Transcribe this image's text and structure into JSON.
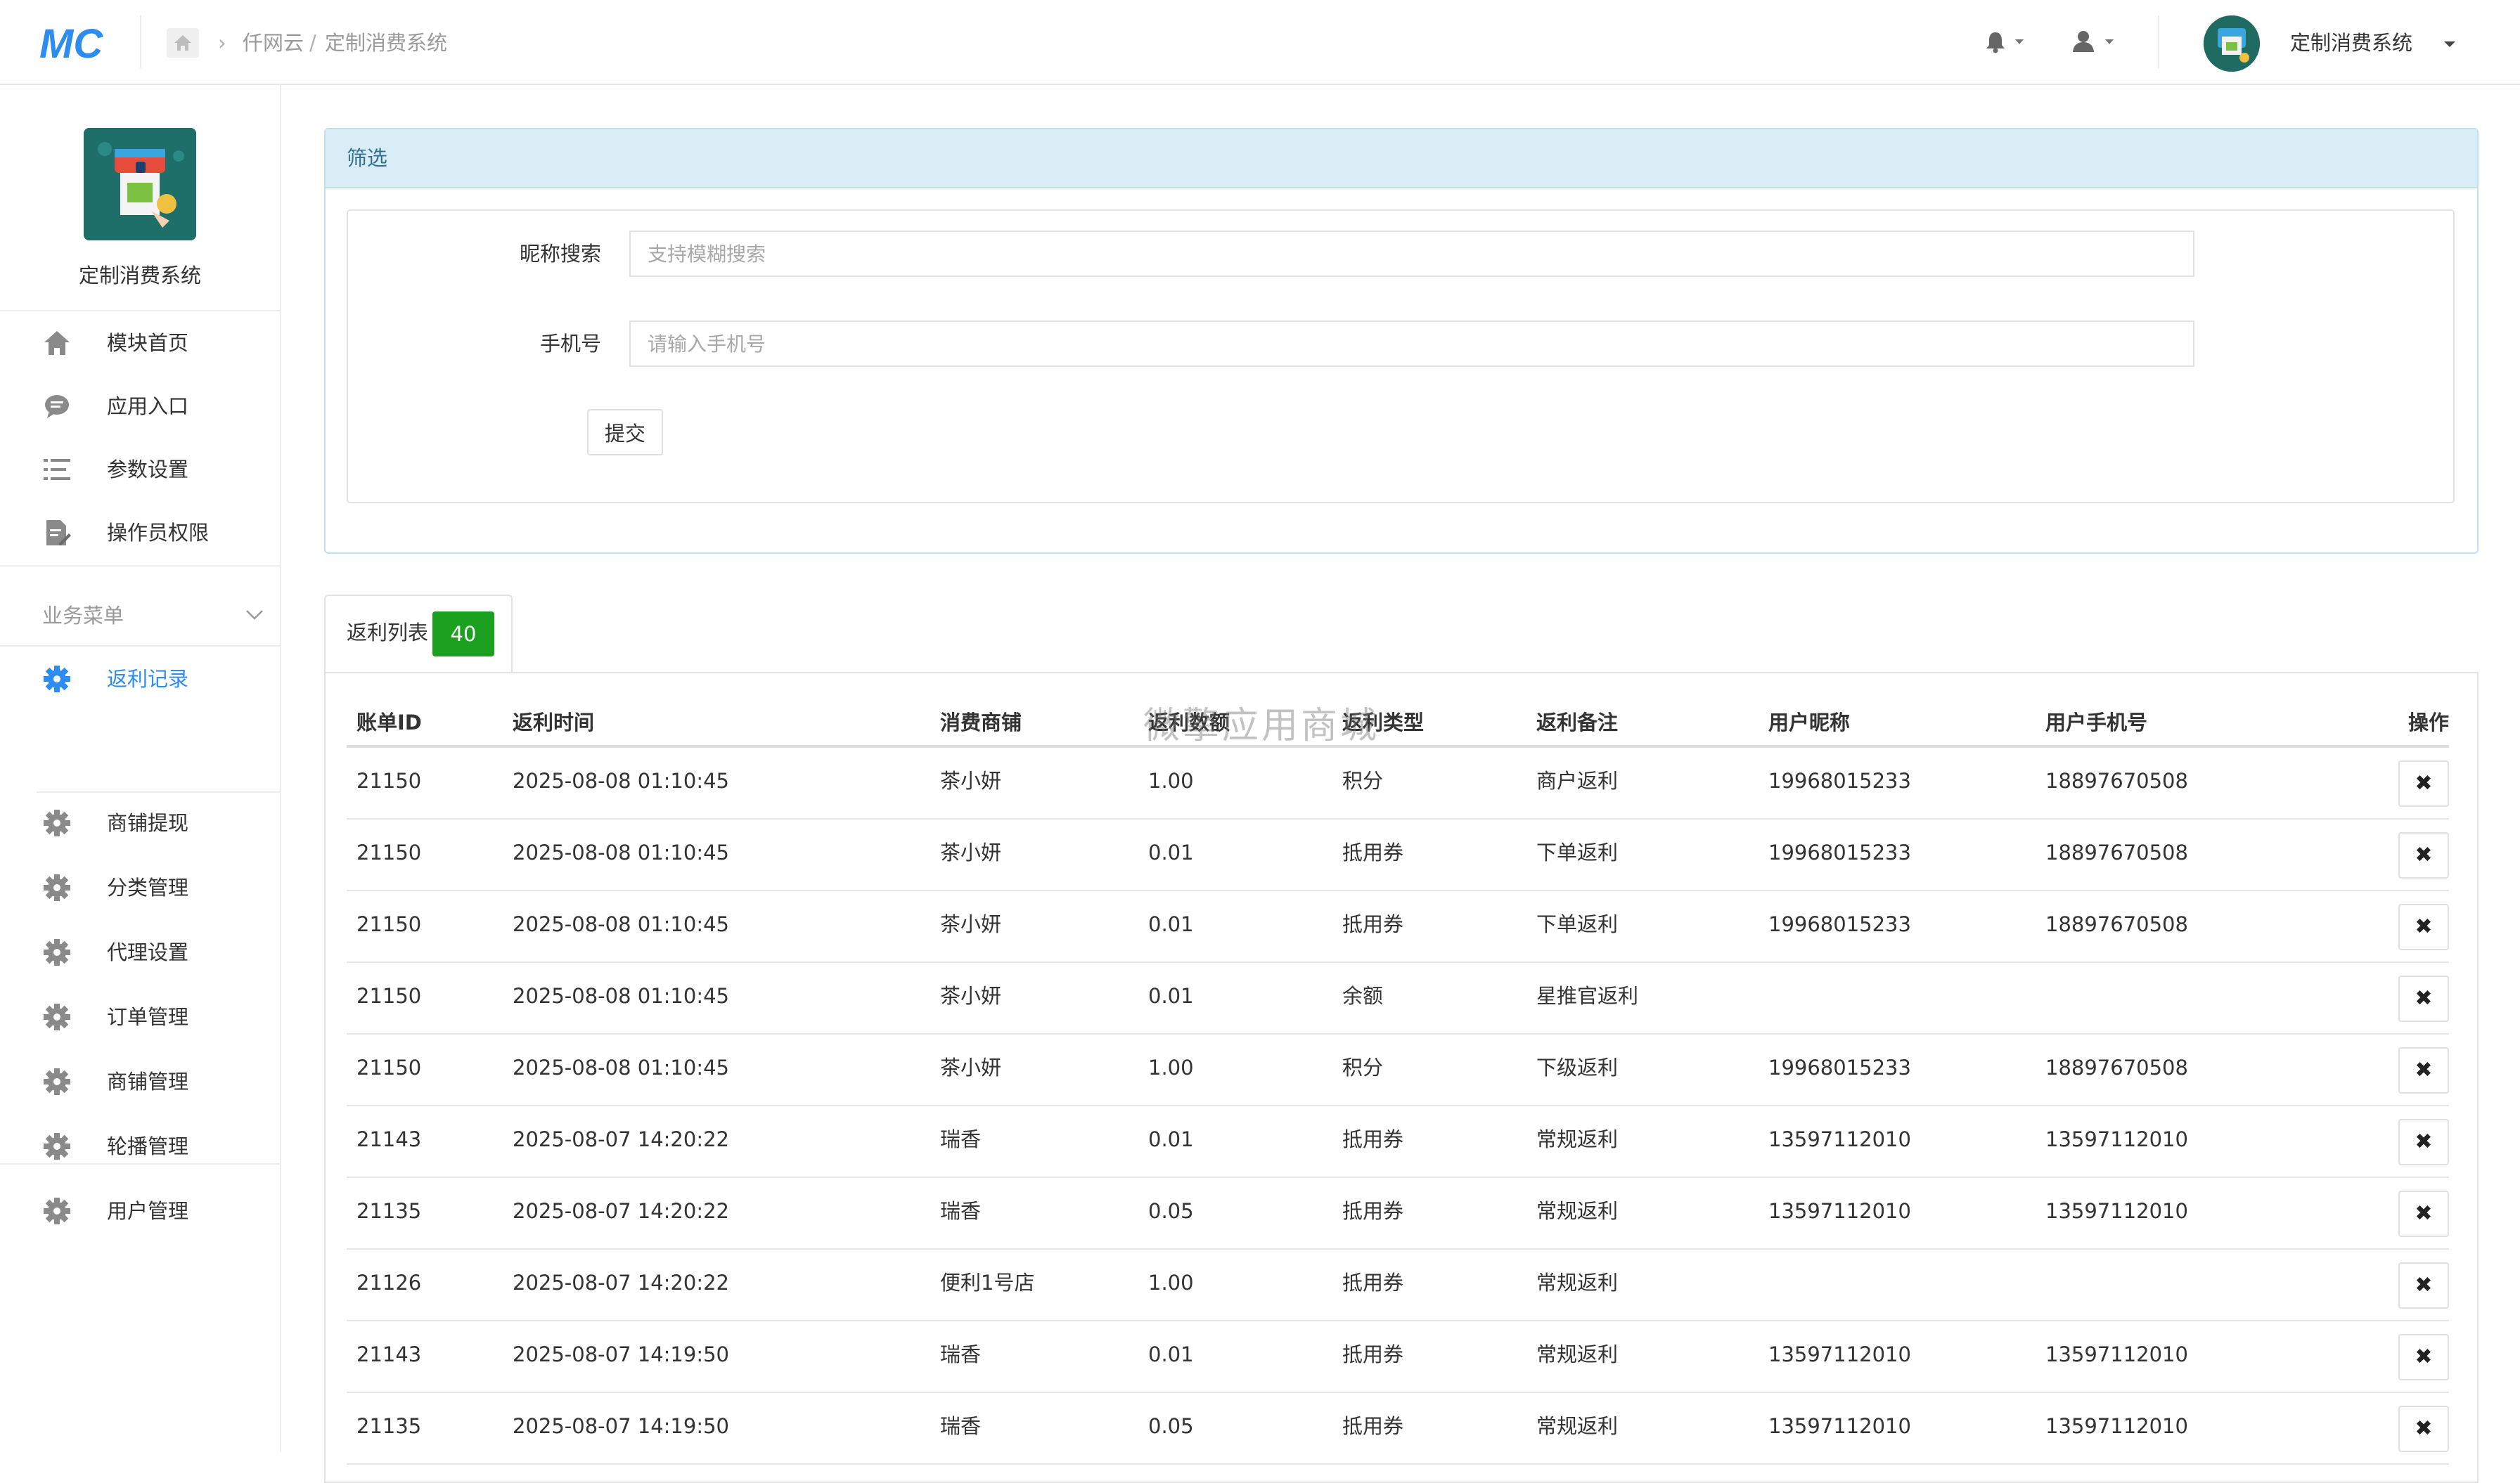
{
  "topbar": {
    "logo_text": "MC",
    "breadcrumb": [
      "仟网云",
      "定制消费系统"
    ],
    "breadcrumb_sep": "/",
    "user_name": "定制消费系统"
  },
  "sidebar": {
    "title": "定制消费系统",
    "top_items": [
      {
        "label": "模块首页",
        "icon": "home-icon"
      },
      {
        "label": "应用入口",
        "icon": "chat-icon"
      },
      {
        "label": "参数设置",
        "icon": "list-icon"
      },
      {
        "label": "操作员权限",
        "icon": "edit-doc-icon"
      }
    ],
    "section_label": "业务菜单",
    "biz_items": [
      {
        "label": "返利记录",
        "active": true
      },
      {
        "label": "商铺提现"
      },
      {
        "label": "分类管理"
      },
      {
        "label": "代理设置"
      },
      {
        "label": "订单管理"
      },
      {
        "label": "商铺管理"
      },
      {
        "label": "轮播管理"
      },
      {
        "label": "用户管理"
      }
    ]
  },
  "filter": {
    "title": "筛选",
    "nickname_label": "昵称搜索",
    "nickname_placeholder": "支持模糊搜索",
    "nickname_value": "",
    "phone_label": "手机号",
    "phone_placeholder": "请输入手机号",
    "phone_value": "",
    "submit_label": "提交"
  },
  "list": {
    "tab_label": "返利列表",
    "count": "40",
    "columns": [
      "账单ID",
      "返利时间",
      "消费商铺",
      "返利数额",
      "返利类型",
      "返利备注",
      "用户昵称",
      "用户手机号",
      "操作"
    ],
    "rows": [
      [
        "21150",
        "2025-08-08 01:10:45",
        "茶小妍",
        "1.00",
        "积分",
        "商户返利",
        "19968015233",
        "18897670508"
      ],
      [
        "21150",
        "2025-08-08 01:10:45",
        "茶小妍",
        "0.01",
        "抵用券",
        "下单返利",
        "19968015233",
        "18897670508"
      ],
      [
        "21150",
        "2025-08-08 01:10:45",
        "茶小妍",
        "0.01",
        "抵用券",
        "下单返利",
        "19968015233",
        "18897670508"
      ],
      [
        "21150",
        "2025-08-08 01:10:45",
        "茶小妍",
        "0.01",
        "余额",
        "星推官返利",
        "",
        ""
      ],
      [
        "21150",
        "2025-08-08 01:10:45",
        "茶小妍",
        "1.00",
        "积分",
        "下级返利",
        "19968015233",
        "18897670508"
      ],
      [
        "21143",
        "2025-08-07 14:20:22",
        "瑞香",
        "0.01",
        "抵用券",
        "常规返利",
        "13597112010",
        "13597112010"
      ],
      [
        "21135",
        "2025-08-07 14:20:22",
        "瑞香",
        "0.05",
        "抵用券",
        "常规返利",
        "13597112010",
        "13597112010"
      ],
      [
        "21126",
        "2025-08-07 14:20:22",
        "便利1号店",
        "1.00",
        "抵用券",
        "常规返利",
        "",
        ""
      ],
      [
        "21143",
        "2025-08-07 14:19:50",
        "瑞香",
        "0.01",
        "抵用券",
        "常规返利",
        "13597112010",
        "13597112010"
      ],
      [
        "21135",
        "2025-08-07 14:19:50",
        "瑞香",
        "0.05",
        "抵用券",
        "常规返利",
        "13597112010",
        "13597112010"
      ]
    ],
    "delete_symbol": "✖"
  },
  "watermark": "微擎应用商城",
  "colors": {
    "accent": "#2d8cf0",
    "badge": "#1ba11f",
    "filter_head_bg": "#d9edf7",
    "filter_head_text": "#31708f"
  }
}
